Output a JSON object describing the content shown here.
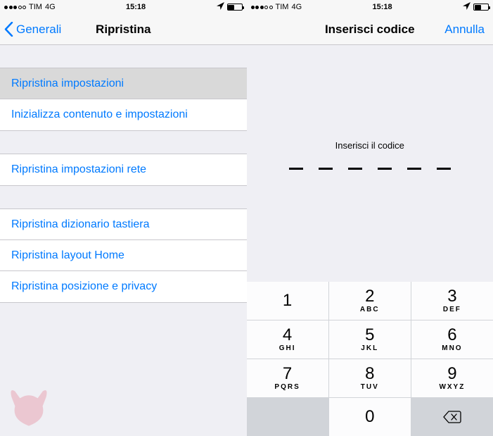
{
  "status": {
    "carrier": "TIM",
    "network": "4G",
    "time": "15:18"
  },
  "left": {
    "back_label": "Generali",
    "title": "Ripristina",
    "rows": {
      "r1": "Ripristina impostazioni",
      "r2": "Inizializza contenuto e impostazioni",
      "r3": "Ripristina impostazioni rete",
      "r4": "Ripristina dizionario tastiera",
      "r5": "Ripristina layout Home",
      "r6": "Ripristina posizione e privacy"
    }
  },
  "right": {
    "title": "Inserisci codice",
    "cancel": "Annulla",
    "prompt": "Inserisci il codice",
    "passcode_length": 6
  },
  "keypad": {
    "k1": "1",
    "l1": "",
    "k2": "2",
    "l2": "ABC",
    "k3": "3",
    "l3": "DEF",
    "k4": "4",
    "l4": "GHI",
    "k5": "5",
    "l5": "JKL",
    "k6": "6",
    "l6": "MNO",
    "k7": "7",
    "l7": "PQRS",
    "k8": "8",
    "l8": "TUV",
    "k9": "9",
    "l9": "WXYZ",
    "k0": "0",
    "l0": ""
  }
}
